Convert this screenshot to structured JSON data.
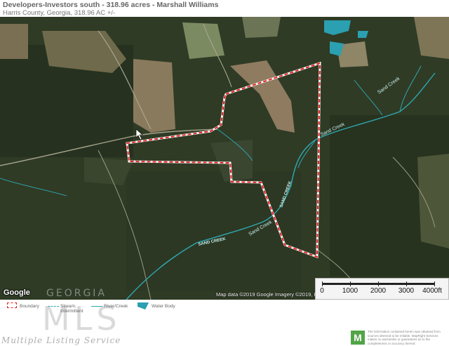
{
  "header": {
    "title": "Developers-Investors south - 318.96 acres - Marshall Williams",
    "subtitle": "Harris County, Georgia, 318.96 AC +/-"
  },
  "map": {
    "labels": {
      "sand_creek_1": "Sand Creek",
      "sand_creek_2": "Sand Creek",
      "sand_creek_3": "SAND CREEK",
      "sand_creek_4": "SAND CREEK",
      "sand_creek_5": "Sand Creek"
    },
    "attribution": "Map data ©2019 Google Imagery ©2019, Dig",
    "google_logo": "Google",
    "scale": {
      "labels": [
        "0",
        "1000",
        "2000",
        "3000",
        "4000ft"
      ]
    },
    "colors": {
      "boundary": "#e02020",
      "stream": "#2fa8b4",
      "water_body": "#2aa0b0"
    }
  },
  "legend": {
    "boundary": "Boundary",
    "stream": "Stream, Intermittent",
    "river": "River/Creek",
    "water_body": "Water Body"
  },
  "watermark": {
    "overlay": "GEORGIA",
    "logo_text": "MLS",
    "tagline": "Multiple Listing Service"
  },
  "disclaimer": {
    "badge": "M",
    "text": "The information contained herein was obtained from sources deemed to be reliable. MapRight Services makes no warranties or guarantees as to the completeness or accuracy thereof."
  }
}
